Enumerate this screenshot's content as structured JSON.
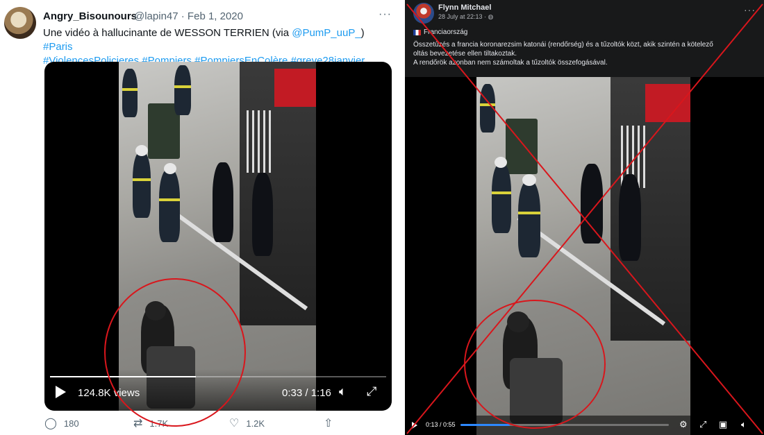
{
  "twitter": {
    "author_name": "Angry_Bisounours",
    "author_handle_date": "@lapin47 · Feb 1, 2020",
    "more_label": "···",
    "text_plain": "Une vidéo à hallucinante de WESSON TERRIEN (via ",
    "mention": "@PumP_uuP_",
    "text_close": ") ",
    "hashtags_line1": "#Paris",
    "hashtags_line2": "#ViolencesPolicieres #Pompiers #PompiersEnColère #greve28janvier",
    "video": {
      "views": "124.8K views",
      "time": "0:33 / 1:16",
      "progress": 0.434
    },
    "actions": {
      "replies": "180",
      "retweets": "1.7K",
      "likes": "1.2K"
    }
  },
  "facebook": {
    "author_name": "Flynn Mitchael",
    "post_time": "28 July at 22:13 · ",
    "more_label": "···",
    "location": "Franciaország",
    "text_line1": "Összetűzés a francia koronarezsim katonái (rendőrség) és a tűzoltók közt, akik szintén a kötelező",
    "text_line2": "oltás bevezetése ellen tiltakoztak.",
    "text_line3": "A rendőrök azonban nem számoltak a tűzoltók összefogásával.",
    "video": {
      "timecode": "0:13 / 0:55",
      "progress": 0.236
    }
  },
  "colors": {
    "annotation_red": "#d9161c",
    "twitter_link": "#1d9bf0",
    "facebook_progress": "#2d88ff"
  },
  "icons": {
    "reply": "comment-icon",
    "retweet": "retweet-icon",
    "like": "heart-icon",
    "share": "share-icon",
    "settings": "gear-icon",
    "fullscreen": "expand-icon",
    "pip": "picture-in-picture-icon",
    "volume": "volume-icon"
  }
}
